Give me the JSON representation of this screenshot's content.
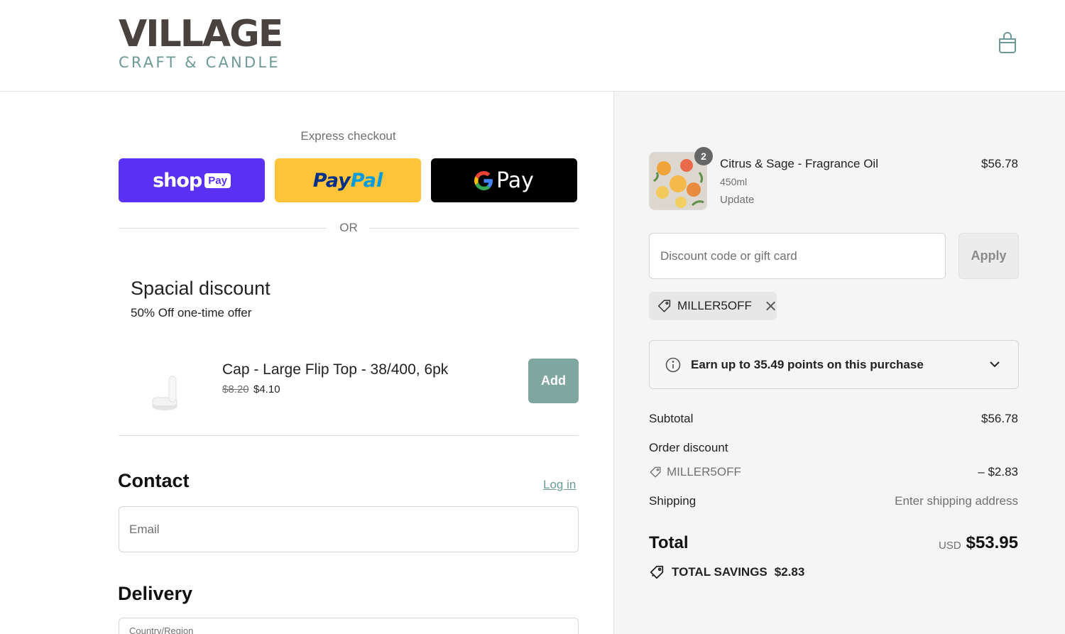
{
  "brand": {
    "name_main": "VILLAGE",
    "name_sub": "CRAFT & CANDLE"
  },
  "header": {
    "cart_icon": "shopping-bag-icon"
  },
  "express": {
    "title": "Express checkout",
    "shop_word": "shop",
    "shop_badge": "Pay",
    "paypal_part1": "Pay",
    "paypal_part2": "Pal",
    "gpay_word": "Pay",
    "or_text": "OR",
    "colors": {
      "shop": "#5a31f4",
      "paypal": "#ffc439",
      "gpay": "#000000"
    }
  },
  "upsell": {
    "title": "Spacial discount",
    "subtitle": "50% Off one-time offer",
    "product_name": "Cap - Large Flip Top - 38/400, 6pk",
    "price_old": "$8.20",
    "price_new": "$4.10",
    "add_label": "Add"
  },
  "contact": {
    "title": "Contact",
    "login_label": "Log in",
    "email_placeholder": "Email"
  },
  "delivery": {
    "title": "Delivery",
    "country_label": "Country/Region"
  },
  "summary": {
    "item": {
      "quantity": "2",
      "name": "Citrus & Sage - Fragrance Oil",
      "variant": "450ml",
      "update_label": "Update",
      "price": "$56.78"
    },
    "discount_placeholder": "Discount code or gift card",
    "apply_label": "Apply",
    "applied_code": "MILLER5OFF",
    "points_text": "Earn up to 35.49 points on this purchase",
    "subtotal_label": "Subtotal",
    "subtotal_value": "$56.78",
    "order_discount_label": "Order discount",
    "order_discount_code": "MILLER5OFF",
    "order_discount_value": "– $2.83",
    "shipping_label": "Shipping",
    "shipping_value": "Enter shipping address",
    "total_label": "Total",
    "total_currency": "USD",
    "total_value": "$53.95",
    "savings_label": "TOTAL SAVINGS",
    "savings_value": "$2.83",
    "accent_color": "#6d9a96"
  }
}
